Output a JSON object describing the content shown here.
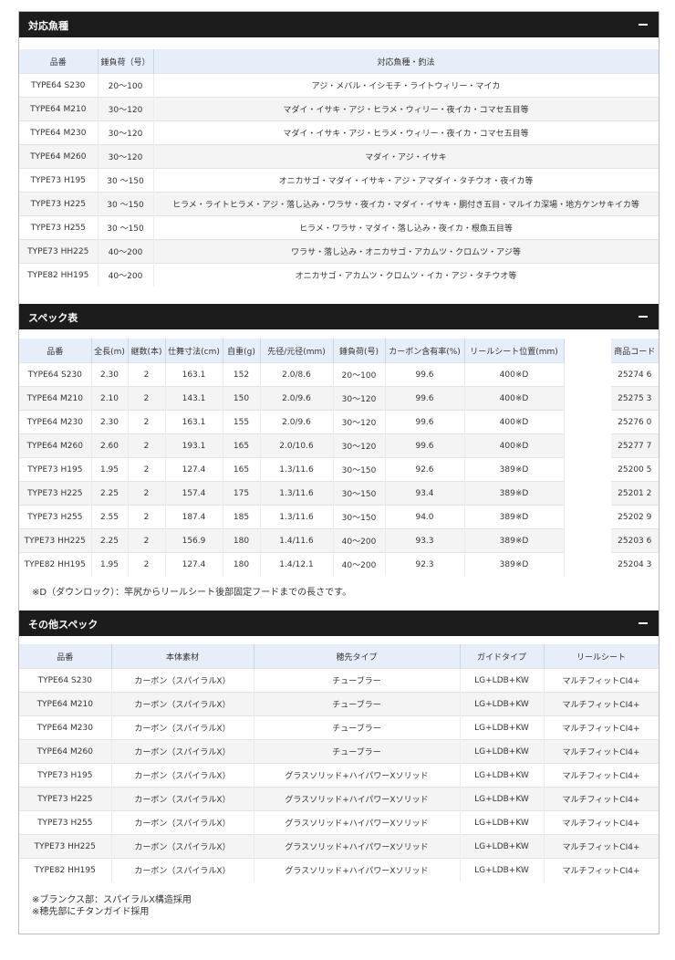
{
  "sections": {
    "fish": {
      "title": "対応魚種",
      "headers": [
        "品番",
        "錘負荷（号）",
        "対応魚種・釣法"
      ],
      "rows": [
        [
          "TYPE64 S230",
          "20～100",
          "アジ・メバル・イシモチ・ライトウィリー・マイカ"
        ],
        [
          "TYPE64 M210",
          "30～120",
          "マダイ・イサキ・アジ・ヒラメ・ウィリー・夜イカ・コマセ五目等"
        ],
        [
          "TYPE64 M230",
          "30～120",
          "マダイ・イサキ・アジ・ヒラメ・ウィリー・夜イカ・コマセ五目等"
        ],
        [
          "TYPE64 M260",
          "30～120",
          "マダイ・アジ・イサキ"
        ],
        [
          "TYPE73 H195",
          "30 ～150",
          "オニカサゴ・マダイ・イサキ・アジ・アマダイ・タチウオ・夜イカ等"
        ],
        [
          "TYPE73 H225",
          "30 ～150",
          "ヒラメ・ライトヒラメ・アジ・落し込み・ワラサ・夜イカ・マダイ・イサキ・胴付き五目・マルイカ深場・地方ケンサキイカ等"
        ],
        [
          "TYPE73 H255",
          "30 ～150",
          "ヒラメ・ワラサ・マダイ・落し込み・夜イカ・根魚五目等"
        ],
        [
          "TYPE73 HH225",
          "40～200",
          "ワラサ・落し込み・オニカサゴ・アカムツ・クロムツ・アジ等"
        ],
        [
          "TYPE82 HH195",
          "40～200",
          "オニカサゴ・アカムツ・クロムツ・イカ・アジ・タチウオ等"
        ]
      ]
    },
    "spec": {
      "title": "スペック表",
      "headers": [
        "品番",
        "全長(m)",
        "継数(本)",
        "仕舞寸法(cm)",
        "自重(g)",
        "先径/元径(mm)",
        "錘負荷(号)",
        "カーボン含有率(%)",
        "リールシート位置(mm)",
        "",
        "商品コード"
      ],
      "rows": [
        [
          "TYPE64 S230",
          "2.30",
          "2",
          "163.1",
          "152",
          "2.0/8.6",
          "20～100",
          "99.6",
          "400※D",
          "",
          "25274 6"
        ],
        [
          "TYPE64 M210",
          "2.10",
          "2",
          "143.1",
          "150",
          "2.0/9.6",
          "30～120",
          "99.6",
          "400※D",
          "",
          "25275 3"
        ],
        [
          "TYPE64 M230",
          "2.30",
          "2",
          "163.1",
          "155",
          "2.0/9.6",
          "30～120",
          "99.6",
          "400※D",
          "",
          "25276 0"
        ],
        [
          "TYPE64 M260",
          "2.60",
          "2",
          "193.1",
          "165",
          "2.0/10.6",
          "30～120",
          "99.6",
          "400※D",
          "",
          "25277 7"
        ],
        [
          "TYPE73 H195",
          "1.95",
          "2",
          "127.4",
          "165",
          "1.3/11.6",
          "30～150",
          "92.6",
          "389※D",
          "",
          "25200 5"
        ],
        [
          "TYPE73 H225",
          "2.25",
          "2",
          "157.4",
          "175",
          "1.3/11.6",
          "30～150",
          "93.4",
          "389※D",
          "",
          "25201 2"
        ],
        [
          "TYPE73 H255",
          "2.55",
          "2",
          "187.4",
          "185",
          "1.3/11.6",
          "30～150",
          "94.0",
          "389※D",
          "",
          "25202 9"
        ],
        [
          "TYPE73 HH225",
          "2.25",
          "2",
          "156.9",
          "180",
          "1.4/11.6",
          "40～200",
          "93.3",
          "389※D",
          "",
          "25203 6"
        ],
        [
          "TYPE82 HH195",
          "1.95",
          "2",
          "127.4",
          "180",
          "1.4/12.1",
          "40～200",
          "92.3",
          "389※D",
          "",
          "25204 3"
        ]
      ],
      "note": "※D（ダウンロック）：竿尻からリールシート後部固定フードまでの長さです。"
    },
    "other": {
      "title": "その他スペック",
      "headers": [
        "品番",
        "本体素材",
        "穂先タイプ",
        "ガイドタイプ",
        "リールシート"
      ],
      "rows": [
        [
          "TYPE64 S230",
          "カーボン（スパイラルX）",
          "チューブラー",
          "LG+LDB+KW",
          "マルチフィットCI4+"
        ],
        [
          "TYPE64 M210",
          "カーボン（スパイラルX）",
          "チューブラー",
          "LG+LDB+KW",
          "マルチフィットCI4+"
        ],
        [
          "TYPE64 M230",
          "カーボン（スパイラルX）",
          "チューブラー",
          "LG+LDB+KW",
          "マルチフィットCI4+"
        ],
        [
          "TYPE64 M260",
          "カーボン（スパイラルX）",
          "チューブラー",
          "LG+LDB+KW",
          "マルチフィットCI4+"
        ],
        [
          "TYPE73 H195",
          "カーボン（スパイラルX）",
          "グラスソリッド+ハイパワーXソリッド",
          "LG+LDB+KW",
          "マルチフィットCI4+"
        ],
        [
          "TYPE73 H225",
          "カーボン（スパイラルX）",
          "グラスソリッド+ハイパワーXソリッド",
          "LG+LDB+KW",
          "マルチフィットCI4+"
        ],
        [
          "TYPE73 H255",
          "カーボン（スパイラルX）",
          "グラスソリッド+ハイパワーXソリッド",
          "LG+LDB+KW",
          "マルチフィットCI4+"
        ],
        [
          "TYPE73 HH225",
          "カーボン（スパイラルX）",
          "グラスソリッド+ハイパワーXソリッド",
          "LG+LDB+KW",
          "マルチフィットCI4+"
        ],
        [
          "TYPE82 HH195",
          "カーボン（スパイラルX）",
          "グラスソリッド+ハイパワーXソリッド",
          "LG+LDB+KW",
          "マルチフィットCI4+"
        ]
      ],
      "notes": [
        "※ブランクス部：スパイラルX構造採用",
        "※穂先部にチタンガイド採用"
      ]
    }
  },
  "icons": {
    "collapse": "minus-icon"
  }
}
